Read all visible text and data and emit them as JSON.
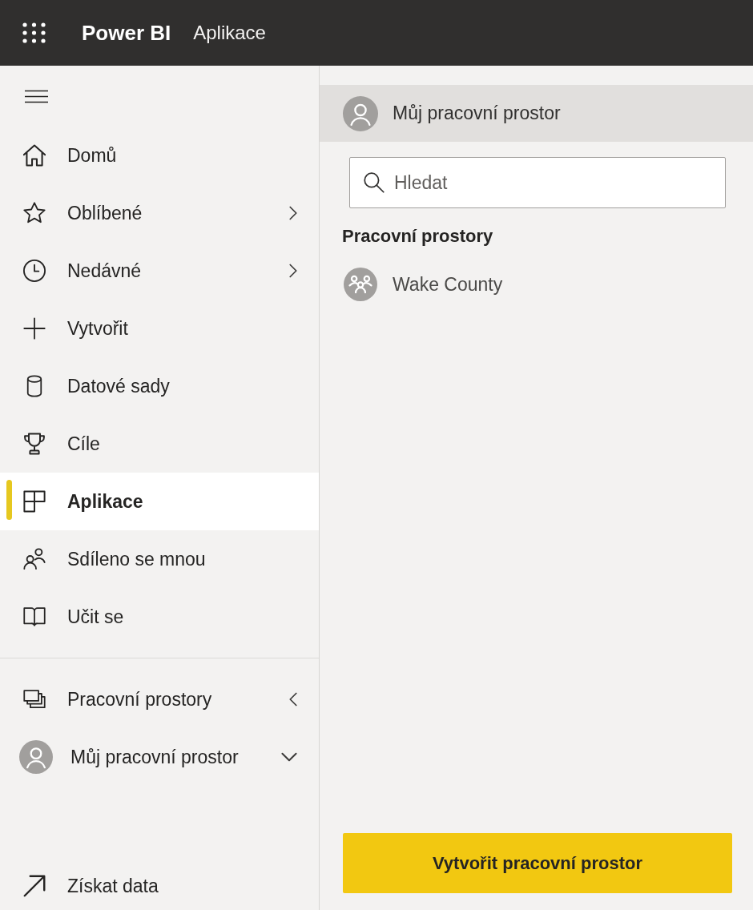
{
  "top_bar": {
    "app_name": "Power BI",
    "page_title": "Aplikace"
  },
  "sidebar": {
    "nav": [
      {
        "label": "Domů",
        "kind": "link",
        "selected": false
      },
      {
        "label": "Oblíbené",
        "kind": "flyout",
        "expanded": false,
        "selected": false
      },
      {
        "label": "Nedávné",
        "kind": "flyout",
        "expanded": false,
        "selected": false
      },
      {
        "label": "Vytvořit",
        "kind": "link",
        "selected": false
      },
      {
        "label": "Datové sady",
        "kind": "link",
        "selected": false
      },
      {
        "label": "Cíle",
        "kind": "link",
        "selected": false
      },
      {
        "label": "Aplikace",
        "kind": "link",
        "selected": true
      },
      {
        "label": "Sdíleno se mnou",
        "kind": "link",
        "selected": false
      },
      {
        "label": "Učit se",
        "kind": "link",
        "selected": false
      }
    ],
    "workspace_nav": [
      {
        "label": "Pracovní prostory",
        "kind": "flyout",
        "expanded": true,
        "selected": false
      },
      {
        "label": "Můj pracovní prostor",
        "kind": "dropdown",
        "expanded": false,
        "selected": false
      }
    ],
    "footer_nav": [
      {
        "label": "Získat data",
        "selected": false
      }
    ]
  },
  "workspace_panel": {
    "current_workspace": {
      "label": "Můj pracovní prostor",
      "selected": true
    },
    "search": {
      "placeholder": "Hledat"
    },
    "section_title": "Pracovní prostory",
    "workspaces": [
      {
        "label": "Wake County",
        "selected": false
      }
    ],
    "create_button": "Vytvořit pracovní prostor"
  }
}
